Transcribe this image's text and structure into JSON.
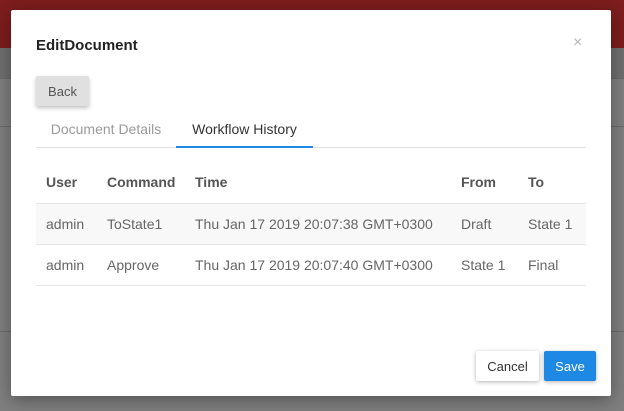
{
  "modal": {
    "title": "EditDocument",
    "close_glyph": "×"
  },
  "toolbar": {
    "back_label": "Back"
  },
  "tabs": [
    {
      "label": "Document Details",
      "active": false
    },
    {
      "label": "Workflow History",
      "active": true
    }
  ],
  "history_table": {
    "columns": [
      "User",
      "Command",
      "Time",
      "From",
      "To"
    ],
    "rows": [
      [
        "admin",
        "ToState1",
        "Thu Jan 17 2019 20:07:38 GMT+0300",
        "Draft",
        "State 1"
      ],
      [
        "admin",
        "Approve",
        "Thu Jan 17 2019 20:07:40 GMT+0300",
        "State 1",
        "Final"
      ]
    ]
  },
  "footer": {
    "cancel_label": "Cancel",
    "save_label": "Save"
  },
  "colors": {
    "accent": "#1e88e5",
    "header_bar": "#7d1d1d"
  }
}
